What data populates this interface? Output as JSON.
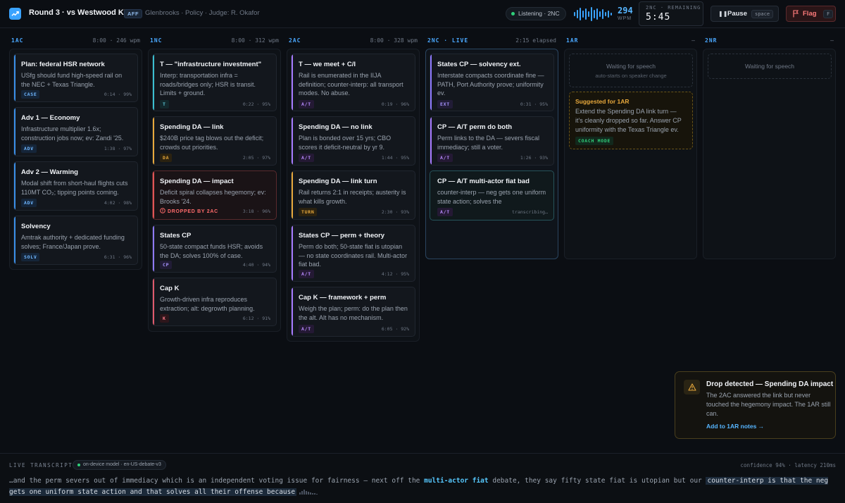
{
  "header": {
    "title": "Round 3 · vs Westwood KM",
    "side_badge": "AFF",
    "meta": "Glenbrooks · Policy · Judge: R. Okafor",
    "listening": "Listening · 2NC",
    "wpm_value": "294",
    "wpm_label": "WPM",
    "timer_label": "2NC · REMAINING",
    "timer_value": "5:45",
    "pause_label": "Pause",
    "pause_key": "space",
    "flag_label": "Flag",
    "flag_key": "F",
    "accent": "#56b5ff"
  },
  "columns": [
    {
      "name": "1AC",
      "info": "8:00 · 246 wpm"
    },
    {
      "name": "1NC",
      "info": "8:00 · 312 wpm"
    },
    {
      "name": "2AC",
      "info": "8:00 · 328 wpm"
    },
    {
      "name": "2NC · LIVE",
      "info": "2:15 elapsed"
    },
    {
      "name": "1AR",
      "info": "—"
    },
    {
      "name": "2NR",
      "info": "—"
    }
  ],
  "cards_1ac": [
    {
      "title": "Plan: federal HSR network",
      "body": "USfg should fund high-speed rail on the NEC + Texas Triangle.",
      "tag": "CASE",
      "meta": "0:14 · 99%"
    },
    {
      "title": "Adv 1 — Economy",
      "body": "Infrastructure multiplier 1.6x; construction jobs now; ev: Zandi '25.",
      "tag": "ADV",
      "meta": "1:38 · 97%"
    },
    {
      "title": "Adv 2 — Warming",
      "body": "Modal shift from short-haul flights cuts 110MT CO₂; tipping points coming.",
      "tag": "ADV",
      "meta": "4:02 · 98%"
    },
    {
      "title": "Solvency",
      "body": "Amtrak authority + dedicated funding solves; France/Japan prove.",
      "tag": "SOLV",
      "meta": "6:31 · 96%"
    }
  ],
  "cards_1nc": [
    {
      "title": "T — \"infrastructure investment\"",
      "body": "Interp: transportation infra = roads/bridges only; HSR is transit. Limits + ground.",
      "tag": "T",
      "meta": "0:22 · 95%"
    },
    {
      "title": "Spending DA — link",
      "body": "$240B price tag blows out the deficit; crowds out priorities.",
      "tag": "DA",
      "meta": "2:05 · 97%"
    },
    {
      "title": "Spending DA — impact",
      "body": "Deficit spiral collapses hegemony; ev: Brooks '24.",
      "tag": "DROPPED BY 2AC",
      "meta": "3:18 · 96%"
    },
    {
      "title": "States CP",
      "body": "50-state compact funds HSR; avoids the DA; solves 100% of case.",
      "tag": "CP",
      "meta": "4:40 · 94%"
    },
    {
      "title": "Cap K",
      "body": "Growth-driven infra reproduces extraction; alt: degrowth planning.",
      "tag": "K",
      "meta": "6:12 · 91%"
    }
  ],
  "cards_2ac": [
    {
      "title": "T — we meet + C/I",
      "body": "Rail is enumerated in the IIJA definition; counter-interp: all transport modes. No abuse.",
      "tag": "A/T",
      "meta": "0:19 · 96%"
    },
    {
      "title": "Spending DA — no link",
      "body": "Plan is bonded over 15 yrs; CBO scores it deficit-neutral by yr 9.",
      "tag": "A/T",
      "meta": "1:44 · 95%"
    },
    {
      "title": "Spending DA — link turn",
      "body": "Rail returns 2:1 in receipts; austerity is what kills growth.",
      "tag": "TURN",
      "meta": "2:30 · 93%"
    },
    {
      "title": "States CP — perm + theory",
      "body": "Perm do both; 50-state fiat is utopian — no state coordinates rail. Multi-actor fiat bad.",
      "tag": "A/T",
      "meta": "4:12 · 95%"
    },
    {
      "title": "Cap K — framework + perm",
      "body": "Weigh the plan; perm: do the plan then the alt. Alt has no mechanism.",
      "tag": "A/T",
      "meta": "6:05 · 92%"
    }
  ],
  "cards_2nc": [
    {
      "title": "States CP — solvency ext.",
      "body": "Interstate compacts coordinate fine — PATH, Port Authority prove; uniformity ev.",
      "tag": "EXT",
      "meta": "0:31 · 95%"
    },
    {
      "title": "CP — A/T perm do both",
      "body": "Perm links to the DA — severs fiscal immediacy; still a voter.",
      "tag": "A/T",
      "meta": "1:26 · 93%"
    },
    {
      "title": "CP — A/T multi-actor fiat bad",
      "body": "counter-interp — neg gets one uniform state action; solves the",
      "tag": "A/T",
      "meta": "transcribing…"
    }
  ],
  "col_1ar": {
    "waiting": "Waiting for speech",
    "waiting_sub": "auto-starts on speaker change",
    "suggest_title": "Suggested for 1AR",
    "suggest_body": "Extend the Spending DA link turn — it's cleanly dropped so far. Answer CP uniformity with the Texas Triangle ev.",
    "suggest_tag": "COACH MODE"
  },
  "col_2nr": {
    "waiting": "Waiting for speech"
  },
  "alert": {
    "title": "Drop detected — Spending DA impact",
    "body": "The 2AC answered the link but never touched the hegemony impact. The 1AR still can.",
    "link": "Add to 1AR notes →"
  },
  "transcript": {
    "label": "LIVE TRANSCRIPT",
    "model": "on-device model · en-US-debate-v3",
    "stats": "confidence 94% · latency 210ms",
    "seg1": "…and the perm severs out of immediacy which is an independent voting issue for fairness — next off the ",
    "kw1": "multi-actor fiat",
    "seg2": " debate, they say fifty state fiat is utopian but our ",
    "hl1": "counter-interp is that the neg gets one uniform state action and that solves all their offense because"
  }
}
